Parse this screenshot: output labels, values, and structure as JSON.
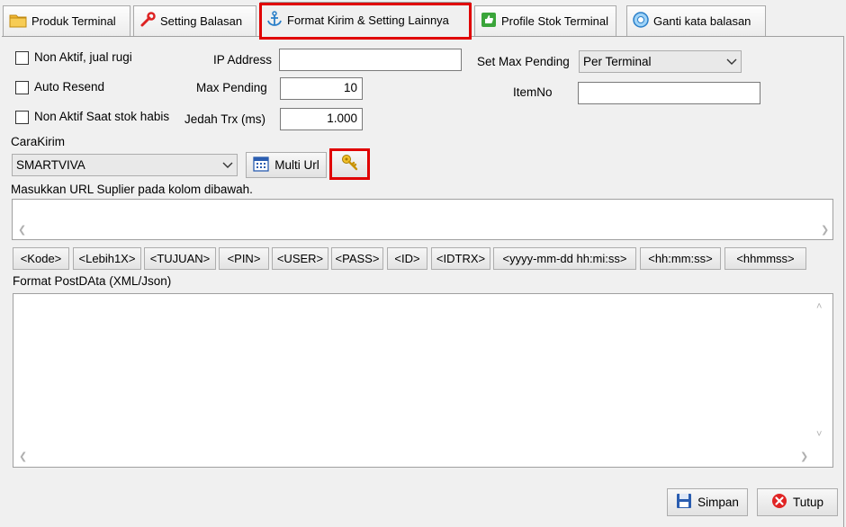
{
  "tabs": [
    {
      "label": "Produk Terminal",
      "icon": "folder-icon"
    },
    {
      "label": "Setting Balasan",
      "icon": "wrench-icon"
    },
    {
      "label": "Format Kirim & Setting Lainnya",
      "icon": "anchor-icon"
    },
    {
      "label": "Profile Stok Terminal",
      "icon": "thumbs-up-icon"
    },
    {
      "label": "Ganti kata balasan",
      "icon": "cd-icon"
    }
  ],
  "options": {
    "non_aktif_jual_rugi": "Non Aktif, jual rugi",
    "auto_resend": "Auto Resend",
    "non_aktif_stok_habis": "Non Aktif Saat stok habis"
  },
  "fields": {
    "ip_address_label": "IP Address",
    "ip_address_value": "",
    "max_pending_label": "Max Pending",
    "max_pending_value": "10",
    "jedah_trx_label": "Jedah Trx (ms)",
    "jedah_trx_value": "1.000",
    "set_max_pending_label": "Set Max Pending",
    "set_max_pending_value": "Per Terminal",
    "itemno_label": "ItemNo",
    "itemno_value": ""
  },
  "cara_kirim": {
    "label": "CaraKirim",
    "value": "SMARTVIVA",
    "multi_url_label": "Multi Url"
  },
  "url_hint": "Masukkan URL Suplier pada kolom dibawah.",
  "tags": [
    "<Kode>",
    "<Lebih1X>",
    "<TUJUAN>",
    "<PIN>",
    "<USER>",
    "<PASS>",
    "<ID>",
    "<IDTRX>",
    "<yyyy-mm-dd hh:mi:ss>",
    "<hh:mm:ss>",
    "<hhmmss>"
  ],
  "postdata_label": "Format PostDAta (XML/Json)",
  "footer": {
    "simpan": "Simpan",
    "tutup": "Tutup"
  },
  "colors": {
    "highlight": "#e00000",
    "background": "#f0f0f0"
  }
}
